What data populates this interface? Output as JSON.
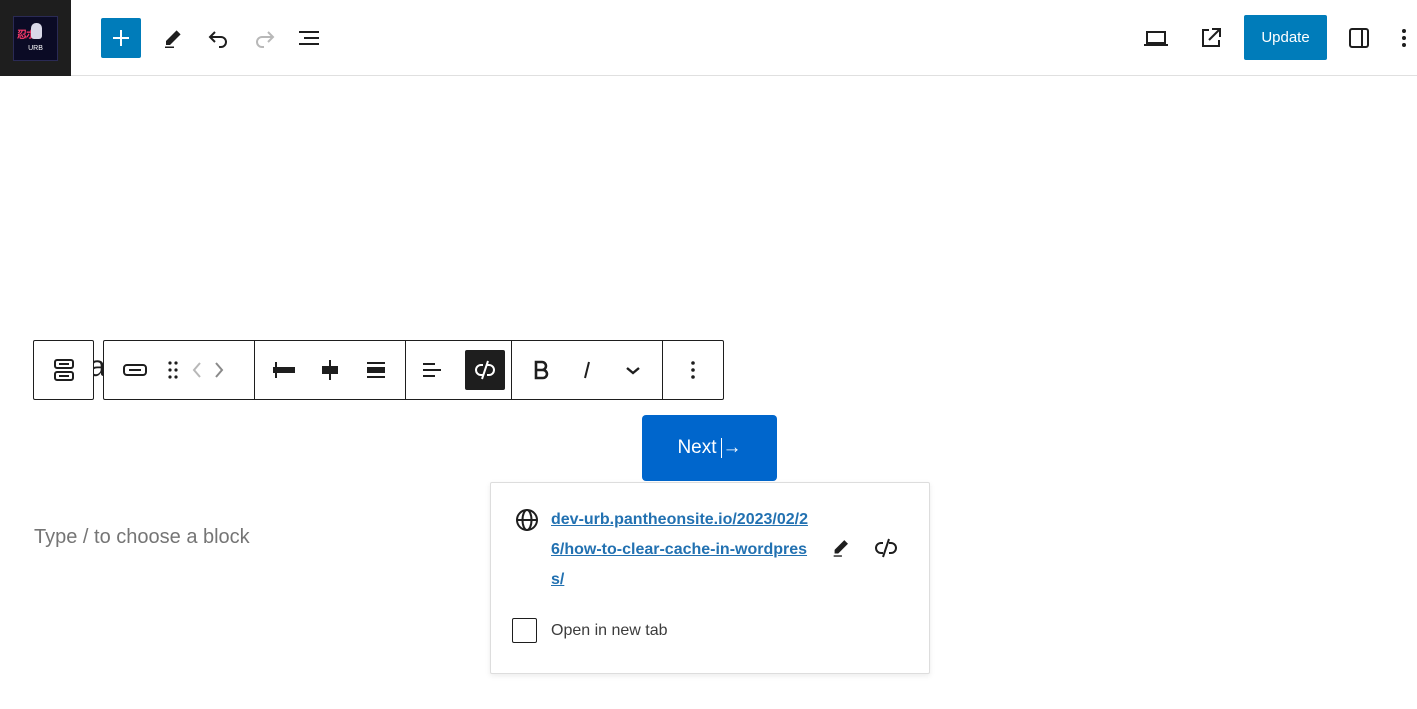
{
  "topbar": {
    "logo_text_top": "忍ボ",
    "logo_text_bottom": "URB",
    "update_label": "Update"
  },
  "icons": {
    "inserter": "plus-icon",
    "tools": "pencil-icon",
    "undo": "undo-icon",
    "redo": "redo-icon",
    "outline": "list-view-icon",
    "preview": "laptop-icon",
    "view_post": "external-link-icon",
    "settings": "sidebar-icon",
    "options": "more-vertical-icon"
  },
  "block_toolbar": {
    "behind_letter": "a"
  },
  "editor": {
    "button_label": "Next",
    "button_arrow": "→",
    "placeholder": "Type / to choose a block"
  },
  "link_popover": {
    "url": "dev-urb.pantheonsite.io/2023/02/26/how-to-clear-cache-in-wordpress/",
    "open_new_tab_label": "Open in new tab",
    "open_new_tab_checked": false
  },
  "colors": {
    "accent": "#007cba",
    "button_bg": "#0066cc",
    "link": "#2271b1",
    "dark": "#1e1e1e",
    "placeholder": "#757575"
  }
}
